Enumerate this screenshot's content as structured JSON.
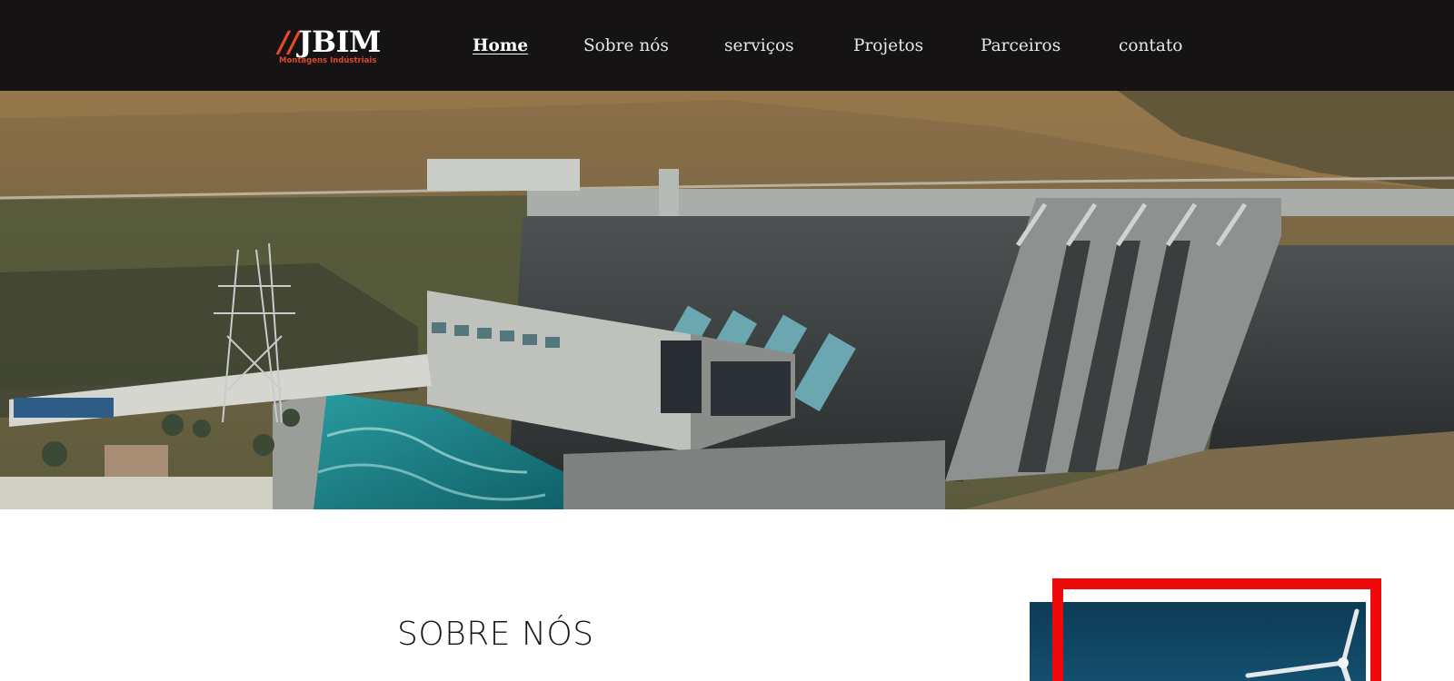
{
  "header": {
    "logo": {
      "mark_slashes": "//",
      "mark_name": "JBIM",
      "tagline": "Montagens Indústriais"
    },
    "nav": [
      {
        "label": "Home",
        "active": true
      },
      {
        "label": "Sobre nós",
        "active": false
      },
      {
        "label": "serviços",
        "active": false
      },
      {
        "label": "Projetos",
        "active": false
      },
      {
        "label": "Parceiros",
        "active": false
      },
      {
        "label": "contato",
        "active": false
      }
    ]
  },
  "hero": {
    "image": "hydroelectric-dam-photo"
  },
  "about": {
    "title": "SOBRE NÓS",
    "image": "wind-turbine-photo"
  },
  "colors": {
    "header_bg": "#151314",
    "accent_red": "#ee0a0a",
    "logo_orange": "#e24a2b"
  }
}
